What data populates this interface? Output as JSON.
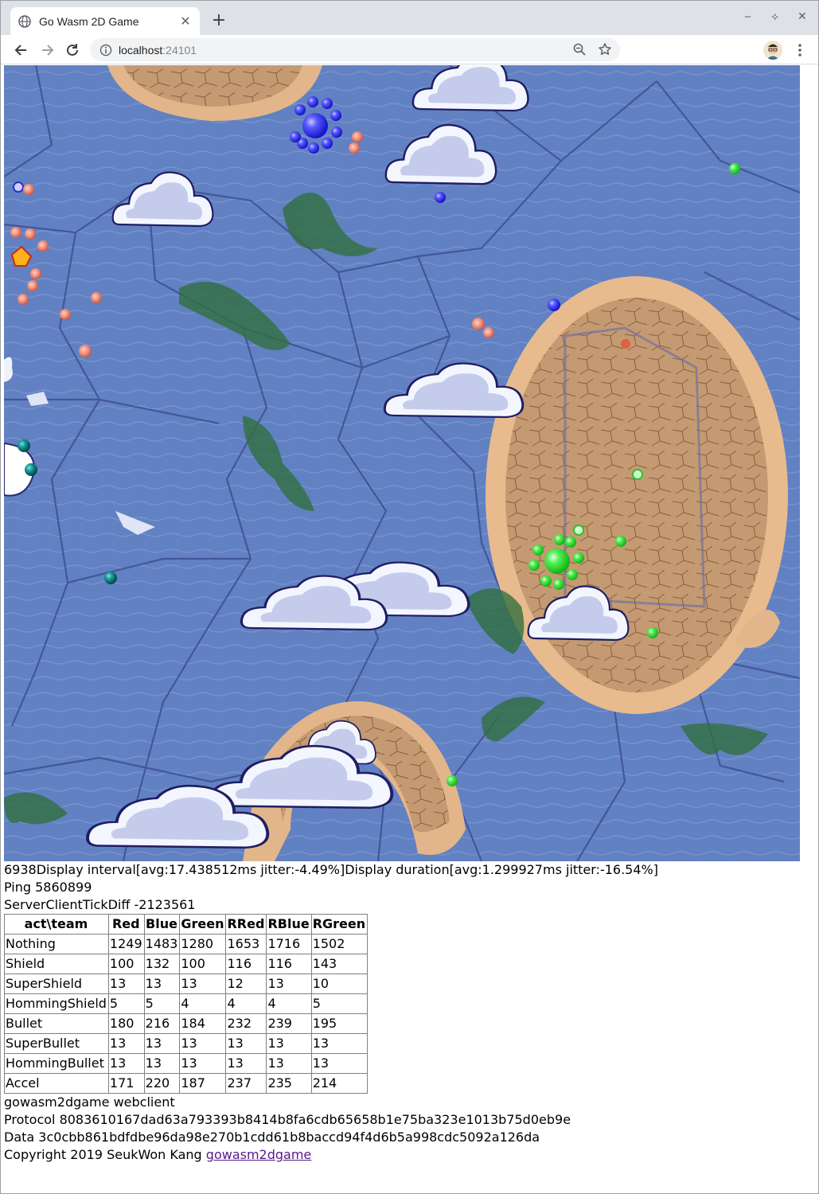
{
  "browser": {
    "tab_title": "Go Wasm 2D Game",
    "new_tab": "+",
    "url_host": "localhost",
    "url_port": ":24101"
  },
  "status": {
    "display_line": "6938Display interval[avg:17.438512ms jitter:-4.49%]Display duration[avg:1.299927ms jitter:-16.54%]",
    "ping_line": "Ping 5860899",
    "tick_line": "ServerClientTickDiff -2123561"
  },
  "table": {
    "headers": [
      "act\\team",
      "Red",
      "Blue",
      "Green",
      "RRed",
      "RBlue",
      "RGreen"
    ],
    "rows": [
      [
        "Nothing",
        "1249",
        "1483",
        "1280",
        "1653",
        "1716",
        "1502"
      ],
      [
        "Shield",
        "100",
        "132",
        "100",
        "116",
        "116",
        "143"
      ],
      [
        "SuperShield",
        "13",
        "13",
        "13",
        "12",
        "13",
        "10"
      ],
      [
        "HommingShield",
        "5",
        "5",
        "4",
        "4",
        "4",
        "5"
      ],
      [
        "Bullet",
        "180",
        "216",
        "184",
        "232",
        "239",
        "195"
      ],
      [
        "SuperBullet",
        "13",
        "13",
        "13",
        "13",
        "13",
        "13"
      ],
      [
        "HommingBullet",
        "13",
        "13",
        "13",
        "13",
        "13",
        "13"
      ],
      [
        "Accel",
        "171",
        "220",
        "187",
        "237",
        "235",
        "214"
      ]
    ]
  },
  "footer": {
    "app_name": "gowasm2dgame webclient",
    "protocol": "Protocol 8083610167dad63a793393b8414b8fa6cdb65658b1e75ba323e1013b75d0eb9e",
    "data": "Data 3c0cbb861bdfdbe96da98e270b1cdd61b8baccd94f4d6b5a998cdc5092a126da",
    "copyright": "Copyright 2019 SeukWon Kang ",
    "link_text": "gowasm2dgame"
  },
  "colors": {
    "ocean": "#5f7fbf",
    "sand": "#d9a877",
    "team_blue": "#3a3aff",
    "team_green": "#35e835",
    "team_red": "#e07060",
    "team_teal": "#1a8a8a"
  },
  "icons": [
    "globe-icon",
    "close-icon",
    "back-icon",
    "forward-icon",
    "reload-icon",
    "info-icon",
    "zoom-out-icon",
    "star-icon",
    "avatar",
    "menu-icon"
  ]
}
